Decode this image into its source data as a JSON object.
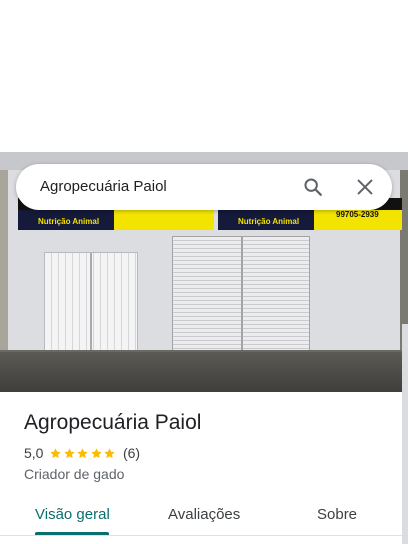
{
  "search": {
    "query": "Agropecuária Paiol"
  },
  "place": {
    "name": "Agropecuária Paiol",
    "rating": "5,0",
    "stars": 5,
    "review_count": "(6)",
    "category": "Criador de gado"
  },
  "photo_sign": {
    "left_text": "Nutrição Animal",
    "right_text": "Nutrição Animal",
    "phone": "99705-2939"
  },
  "tabs": [
    {
      "label": "Visão geral",
      "active": true
    },
    {
      "label": "Avaliações",
      "active": false
    },
    {
      "label": "Sobre",
      "active": false
    }
  ],
  "colors": {
    "accent": "#0b6e6e",
    "star": "#fbbc04",
    "sign_yellow": "#f3e400"
  },
  "icons": {
    "search": "search-icon",
    "close": "close-icon",
    "star": "star-icon"
  }
}
